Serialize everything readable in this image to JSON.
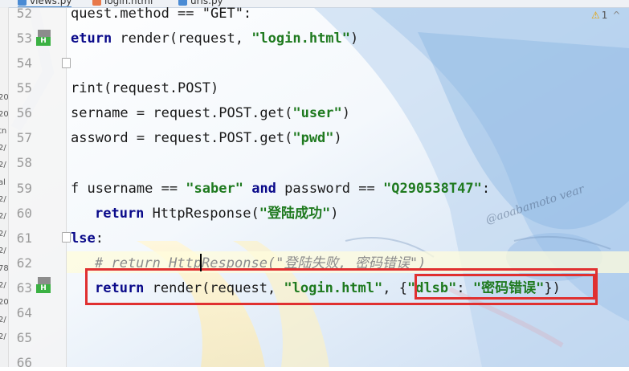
{
  "tabs": [
    {
      "label": "views.py",
      "active": true,
      "icon": "python-file-icon"
    },
    {
      "label": "login.html",
      "active": false,
      "icon": "html-file-icon"
    },
    {
      "label": "urls.py",
      "active": false,
      "icon": "python-file-icon"
    }
  ],
  "sidebar_fragments": [
    "20",
    "20",
    "tn",
    "2/",
    "2/",
    "al",
    "2/",
    "2/",
    "2/",
    "2/",
    "78",
    "2/",
    "20",
    "2/",
    "2/"
  ],
  "inspection": {
    "warnings": "1",
    "icon": "warning-triangle-icon",
    "nav_icon": "chevron-up-icon"
  },
  "gutter_marker_label": "H",
  "lines": [
    {
      "num": "52",
      "code": "quest.method == \"GET\":"
    },
    {
      "num": "53",
      "code": "eturn render(request, \"login.html\")"
    },
    {
      "num": "54",
      "code": ""
    },
    {
      "num": "55",
      "code": "rint(request.POST)"
    },
    {
      "num": "56",
      "code": "sername = request.POST.get(\"user\")"
    },
    {
      "num": "57",
      "code": "assword = request.POST.get(\"pwd\")"
    },
    {
      "num": "58",
      "code": ""
    },
    {
      "num": "59",
      "code": "f username == \"saber\" and password == \"Q290538T47\":"
    },
    {
      "num": "60",
      "code": "return HttpResponse(\"登陆成功\")"
    },
    {
      "num": "61",
      "code": "lse:"
    },
    {
      "num": "62",
      "code": "# return HttpResponse(\"登陆失败, 密码错误\")"
    },
    {
      "num": "63",
      "code": "return render(request, \"login.html\", {\"dlsb\": \"密码错误\"})"
    },
    {
      "num": "64",
      "code": ""
    },
    {
      "num": "65",
      "code": ""
    },
    {
      "num": "66",
      "code": ""
    }
  ],
  "watermark": "@aoabamoto vear",
  "colors": {
    "keyword": "#0a0a8a",
    "string": "#1f7a1f",
    "comment": "#8c8c8c",
    "highlight_box": "#e03030",
    "vcs_added": "#3bb143"
  }
}
